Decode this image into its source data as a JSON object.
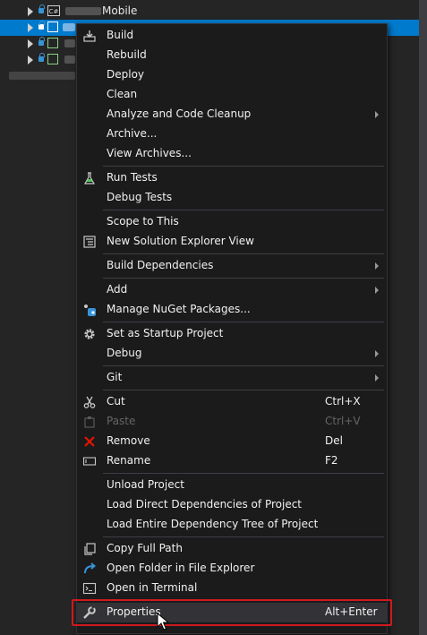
{
  "tree": {
    "rows": [
      {
        "label": "Mobile",
        "icon": "csharp-project-icon",
        "icon_text": "C#"
      },
      {
        "label": "",
        "icon": "mobile-project-icon",
        "selected": true
      },
      {
        "label": "",
        "icon": "android-project-icon"
      },
      {
        "label": "",
        "icon": "uitest-project-icon"
      }
    ]
  },
  "menu": {
    "build": "Build",
    "rebuild": "Rebuild",
    "deploy": "Deploy",
    "clean": "Clean",
    "analyze": "Analyze and Code Cleanup",
    "archive": "Archive...",
    "view_archives": "View Archives...",
    "run_tests": "Run Tests",
    "debug_tests": "Debug Tests",
    "scope_to_this": "Scope to This",
    "new_solution_explorer_view": "New Solution Explorer View",
    "build_dependencies": "Build Dependencies",
    "add": "Add",
    "manage_nuget": "Manage NuGet Packages...",
    "set_startup": "Set as Startup Project",
    "debug": "Debug",
    "git": "Git",
    "cut": "Cut",
    "cut_shortcut": "Ctrl+X",
    "paste": "Paste",
    "paste_shortcut": "Ctrl+V",
    "remove": "Remove",
    "remove_shortcut": "Del",
    "rename": "Rename",
    "rename_shortcut": "F2",
    "unload_project": "Unload Project",
    "load_direct": "Load Direct Dependencies of Project",
    "load_entire": "Load Entire Dependency Tree of Project",
    "copy_full_path": "Copy Full Path",
    "open_folder": "Open Folder in File Explorer",
    "open_terminal": "Open in Terminal",
    "properties": "Properties",
    "properties_shortcut": "Alt+Enter"
  },
  "colors": {
    "selection": "#007acc",
    "menu_bg": "#1b1b1c",
    "highlight_border": "#d0191d"
  }
}
